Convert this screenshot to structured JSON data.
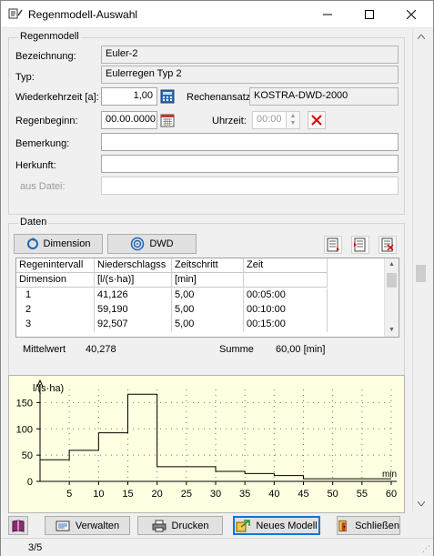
{
  "window": {
    "title": "Regenmodell-Auswahl"
  },
  "regenmodell": {
    "group_label": "Regenmodell",
    "bezeichnung_label": "Bezeichnung:",
    "bezeichnung_value": "Euler-2",
    "typ_label": "Typ:",
    "typ_value": "Eulerregen Typ 2",
    "wiederkehrzeit_label": "Wiederkehrzeit  [a]:",
    "wiederkehrzeit_value": "1,00",
    "rechenansatz_label": "Rechenansatz",
    "rechenansatz_value": "KOSTRA-DWD-2000",
    "regenbeginn_label": "Regenbeginn:",
    "regenbeginn_value": "00.00.0000",
    "uhrzeit_label": "Uhrzeit:",
    "uhrzeit_value": "00:00",
    "bemerkung_label": "Bemerkung:",
    "bemerkung_value": "",
    "herkunft_label": "Herkunft:",
    "herkunft_value": "",
    "aus_datei_label": "aus Datei:",
    "aus_datei_value": ""
  },
  "daten": {
    "group_label": "Daten",
    "dimension_button": "Dimension",
    "dwd_button": "DWD",
    "columns": [
      "Regenintervall",
      "Niederschlagss",
      "Zeitschritt",
      "Zeit"
    ],
    "units": [
      "Dimension",
      "[l/(s·ha)]",
      "[min]",
      ""
    ],
    "rows": [
      [
        "1",
        "41,126",
        "5,00",
        "00:05:00"
      ],
      [
        "2",
        "59,190",
        "5,00",
        "00:10:00"
      ],
      [
        "3",
        "92,507",
        "5,00",
        "00:15:00"
      ]
    ],
    "mittelwert_label": "Mittelwert",
    "mittelwert_value": "40,278",
    "summe_label": "Summe",
    "summe_value": "60,00 [min]"
  },
  "chart_data": {
    "type": "area",
    "ylabel": "l/(s·ha)",
    "xlabel": "min",
    "xlim": [
      0,
      60
    ],
    "ylim": [
      0,
      175
    ],
    "x_ticks": [
      5,
      10,
      15,
      20,
      25,
      30,
      35,
      40,
      45,
      50,
      55,
      60
    ],
    "y_ticks": [
      0,
      50,
      100,
      150
    ],
    "series": [
      {
        "x": [
          0,
          5,
          10,
          15,
          20,
          25,
          30,
          35,
          40,
          45,
          50,
          55,
          60
        ],
        "y": [
          41.126,
          59.19,
          92.507,
          166,
          28,
          28,
          19,
          15,
          11,
          5,
          5,
          5,
          5
        ]
      }
    ],
    "grid": "dotted"
  },
  "buttons": {
    "verwalten": "Verwalten",
    "drucken": "Drucken",
    "neues_modell": "Neues Modell",
    "schliessen": "Schließen"
  },
  "status": {
    "page": "3/5"
  },
  "colors": {
    "chart_bg": "#ffffe1",
    "accent": "#0078d7",
    "delete_red": "#e00000"
  }
}
